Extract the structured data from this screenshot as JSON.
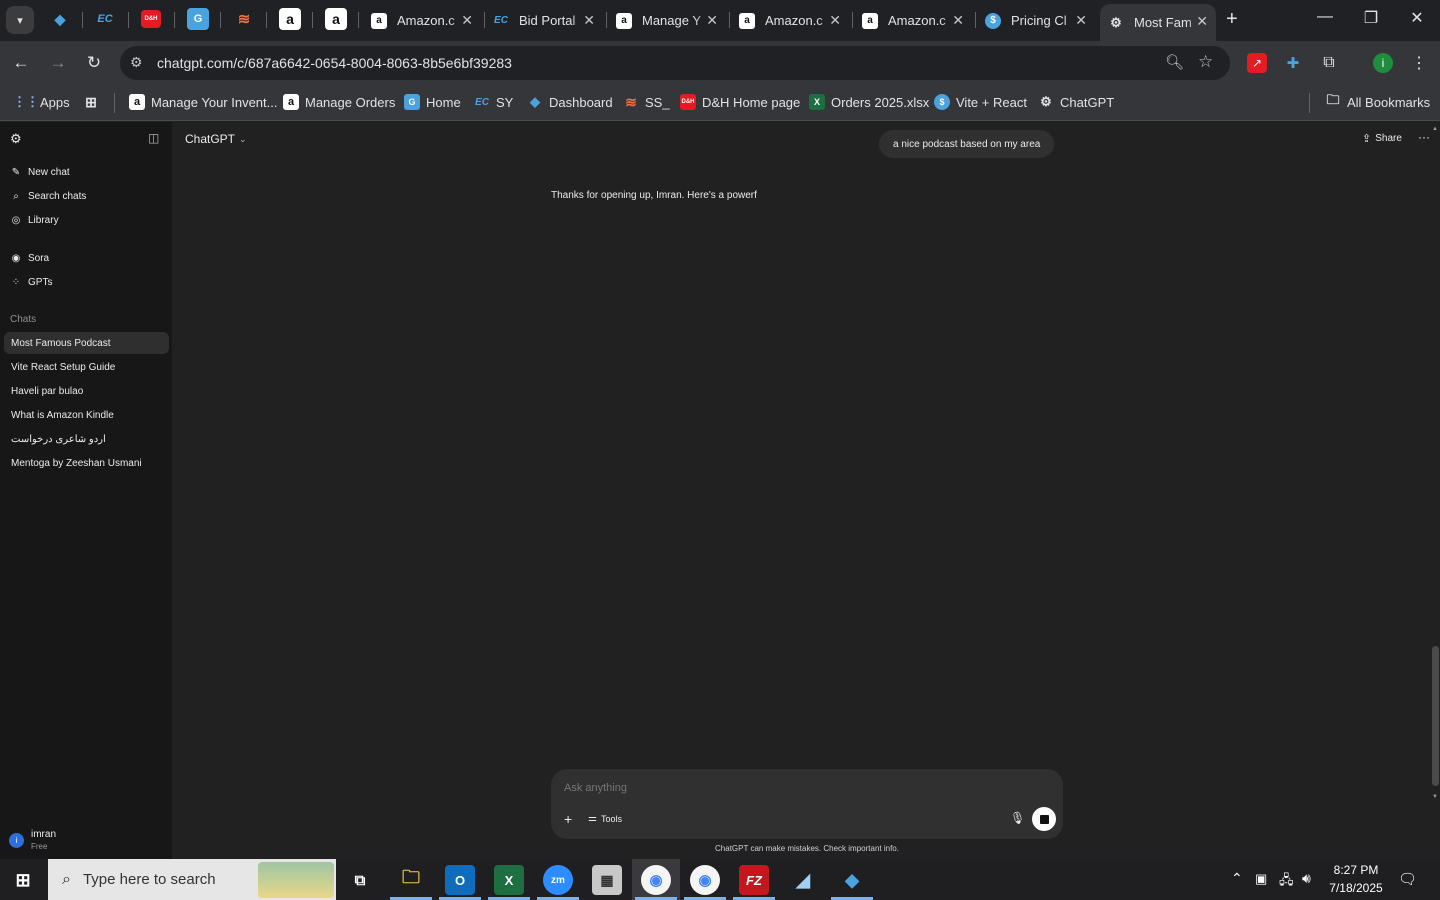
{
  "browser": {
    "pinned_tabs": [
      {
        "icon": "blue-diamond-icon",
        "color": "#4aa3df"
      },
      {
        "icon": "ec-logo-icon",
        "label": "EC",
        "color": "#4aa3df"
      },
      {
        "icon": "dh-logo-icon",
        "label": "D&H",
        "color": "#e31b23"
      },
      {
        "icon": "g-icon",
        "label": "G",
        "color": "#4aa3df"
      },
      {
        "icon": "stack-icon",
        "color": "#e8734a"
      },
      {
        "icon": "amazon-icon",
        "label": "a",
        "color": "#ffffff"
      },
      {
        "icon": "amazon-icon",
        "label": "a",
        "color": "#ffffff"
      }
    ],
    "tabs": [
      {
        "title": "Amazon.c",
        "icon": "amazon-icon",
        "glyph": "a"
      },
      {
        "title": "Bid Portal",
        "icon": "ec-logo-icon",
        "glyph": "EC"
      },
      {
        "title": "Manage Y",
        "icon": "amazon-icon",
        "glyph": "a"
      },
      {
        "title": "Amazon.c",
        "icon": "amazon-icon",
        "glyph": "a"
      },
      {
        "title": "Amazon.c",
        "icon": "amazon-icon",
        "glyph": "a"
      },
      {
        "title": "Pricing Cl",
        "icon": "dollar-icon",
        "glyph": "$"
      },
      {
        "title": "Most Fam",
        "icon": "openai-icon",
        "glyph": "⚙"
      }
    ],
    "url": "chatgpt.com/c/687a6642-0654-8004-8063-8b5e6bf39283",
    "bookmarks": [
      {
        "label": "Apps",
        "icon": "apps-grid-icon"
      },
      {
        "label": "",
        "icon": "tab-groups-icon"
      },
      {
        "label": "Manage Your Invent...",
        "icon": "amazon-icon"
      },
      {
        "label": "Manage Orders",
        "icon": "amazon-icon"
      },
      {
        "label": "Home",
        "icon": "g-icon"
      },
      {
        "label": "SY",
        "icon": "ec-logo-icon"
      },
      {
        "label": "Dashboard",
        "icon": "blue-diamond-icon"
      },
      {
        "label": "SS_",
        "icon": "stack-icon"
      },
      {
        "label": "D&H Home page",
        "icon": "dh-logo-icon"
      },
      {
        "label": "Orders 2025.xlsx",
        "icon": "excel-icon"
      },
      {
        "label": "Vite + React",
        "icon": "dollar-icon"
      },
      {
        "label": "ChatGPT",
        "icon": "openai-icon"
      }
    ],
    "all_bookmarks": "All Bookmarks",
    "profile_initial": "i"
  },
  "app": {
    "model_label": "ChatGPT",
    "nav": [
      {
        "label": "New chat",
        "icon": "compose-icon",
        "glyph": "✎"
      },
      {
        "label": "Search chats",
        "icon": "search-icon",
        "glyph": "⌕"
      },
      {
        "label": "Library",
        "icon": "library-icon",
        "glyph": "◎"
      }
    ],
    "nav2": [
      {
        "label": "Sora",
        "icon": "sora-icon",
        "glyph": "◉"
      },
      {
        "label": "GPTs",
        "icon": "gpts-grid-icon",
        "glyph": "⁘"
      }
    ],
    "chats_heading": "Chats",
    "chats": [
      "Most Famous Podcast",
      "Vite React Setup Guide",
      "Haveli par bulao",
      "What is Amazon Kindle",
      "اردو شاعری درخواست",
      "Mentoga by Zeeshan Usmani"
    ],
    "user": {
      "name": "imran",
      "plan": "Free",
      "initial": "i"
    },
    "share_label": "Share",
    "user_message": "a nice podcast based on my area",
    "assistant_message": "Thanks for opening up, Imran. Here's a powerf",
    "composer": {
      "placeholder": "Ask anything",
      "tools_label": "Tools"
    },
    "disclaimer": "ChatGPT can make mistakes. Check important info."
  },
  "taskbar": {
    "search_placeholder": "Type here to search",
    "time": "8:27 PM",
    "date": "7/18/2025"
  }
}
